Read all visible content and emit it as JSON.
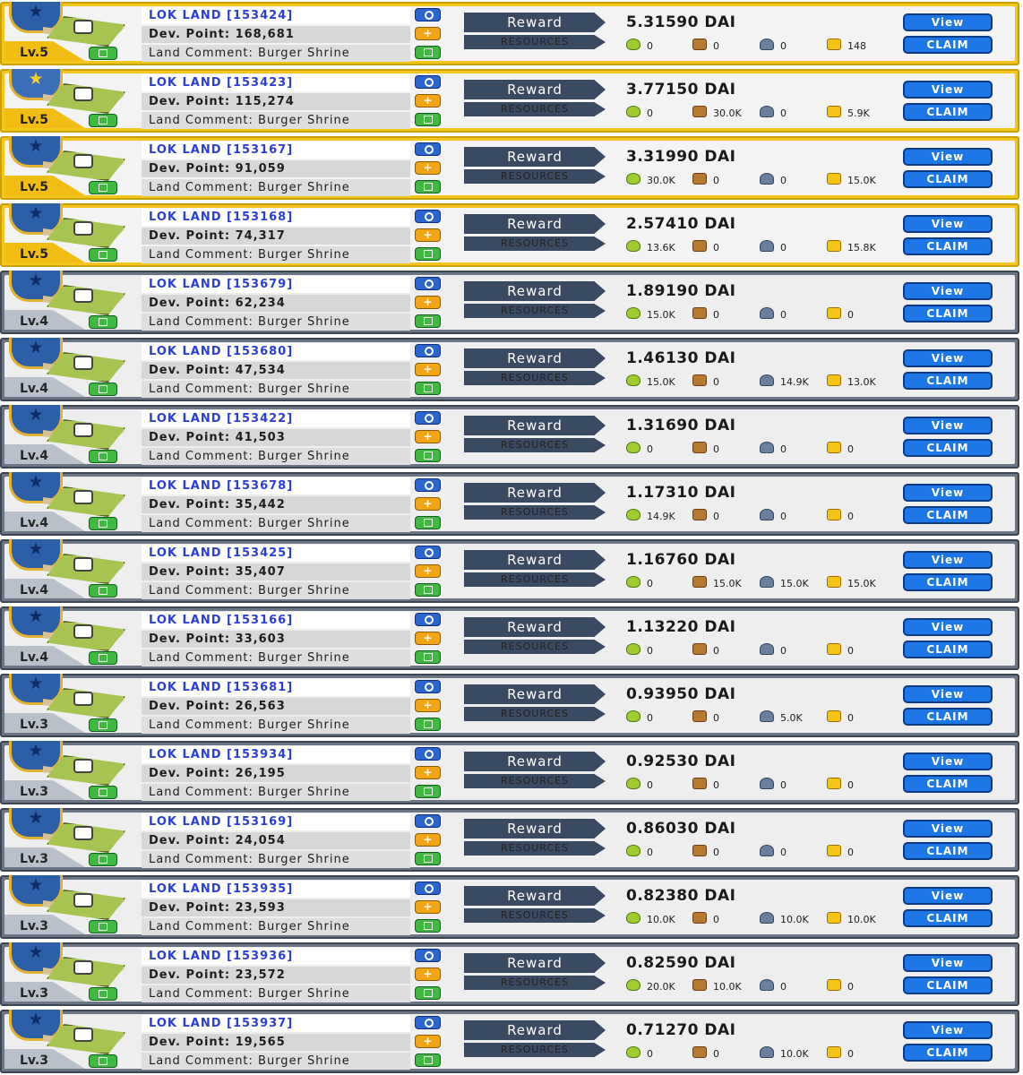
{
  "labels": {
    "reward": "Reward",
    "resources": "RESOURCES",
    "view": "View",
    "claim": "CLAIM"
  },
  "colors": {
    "gold_frame": "#f4c61c",
    "gray_frame": "#6b7584",
    "link_blue": "#2b3fd8",
    "button_blue": "#1d77e6",
    "tag_dark": "#3a4a63"
  },
  "icons": {
    "food": "corn-icon",
    "wood": "wood-icon",
    "stone": "stone-icon",
    "gold": "gold-icon",
    "search": "search-icon",
    "plus": "plus-icon",
    "edit": "edit-icon",
    "level": "star-shield-icon"
  },
  "lands": [
    {
      "tier": "gold",
      "level": "Lv.5",
      "name": "LOK LAND [153424]",
      "dev": "Dev. Point: 168,681",
      "comment": "Land Comment: Burger Shrine",
      "dai": "5.31590 DAI",
      "food": "0",
      "wood": "0",
      "stone": "0",
      "gold": "148"
    },
    {
      "tier": "gold",
      "level": "Lv.5",
      "name": "LOK LAND [153423]",
      "dev": "Dev. Point: 115,274",
      "comment": "Land Comment: Burger Shrine",
      "dai": "3.77150 DAI",
      "food": "0",
      "wood": "30.0K",
      "stone": "0",
      "gold": "5.9K",
      "yellow_star": true
    },
    {
      "tier": "gold",
      "level": "Lv.5",
      "name": "LOK LAND [153167]",
      "dev": "Dev. Point: 91,059",
      "comment": "Land Comment: Burger Shrine",
      "dai": "3.31990 DAI",
      "food": "30.0K",
      "wood": "0",
      "stone": "0",
      "gold": "15.0K"
    },
    {
      "tier": "gold",
      "level": "Lv.5",
      "name": "LOK LAND [153168]",
      "dev": "Dev. Point: 74,317",
      "comment": "Land Comment: Burger Shrine",
      "dai": "2.57410 DAI",
      "food": "13.6K",
      "wood": "0",
      "stone": "0",
      "gold": "15.8K"
    },
    {
      "tier": "gray",
      "level": "Lv.4",
      "name": "LOK LAND [153679]",
      "dev": "Dev. Point: 62,234",
      "comment": "Land Comment: Burger Shrine",
      "dai": "1.89190 DAI",
      "food": "15.0K",
      "wood": "0",
      "stone": "0",
      "gold": "0"
    },
    {
      "tier": "gray",
      "level": "Lv.4",
      "name": "LOK LAND [153680]",
      "dev": "Dev. Point: 47,534",
      "comment": "Land Comment: Burger Shrine",
      "dai": "1.46130 DAI",
      "food": "15.0K",
      "wood": "0",
      "stone": "14.9K",
      "gold": "13.0K"
    },
    {
      "tier": "gray",
      "level": "Lv.4",
      "name": "LOK LAND [153422]",
      "dev": "Dev. Point: 41,503",
      "comment": "Land Comment: Burger Shrine",
      "dai": "1.31690 DAI",
      "food": "0",
      "wood": "0",
      "stone": "0",
      "gold": "0"
    },
    {
      "tier": "gray",
      "level": "Lv.4",
      "name": "LOK LAND [153678]",
      "dev": "Dev. Point: 35,442",
      "comment": "Land Comment: Burger Shrine",
      "dai": "1.17310 DAI",
      "food": "14.9K",
      "wood": "0",
      "stone": "0",
      "gold": "0"
    },
    {
      "tier": "gray",
      "level": "Lv.4",
      "name": "LOK LAND [153425]",
      "dev": "Dev. Point: 35,407",
      "comment": "Land Comment: Burger Shrine",
      "dai": "1.16760 DAI",
      "food": "0",
      "wood": "15.0K",
      "stone": "15.0K",
      "gold": "15.0K"
    },
    {
      "tier": "gray",
      "level": "Lv.4",
      "name": "LOK LAND [153166]",
      "dev": "Dev. Point: 33,603",
      "comment": "Land Comment: Burger Shrine",
      "dai": "1.13220 DAI",
      "food": "0",
      "wood": "0",
      "stone": "0",
      "gold": "0"
    },
    {
      "tier": "gray",
      "level": "Lv.3",
      "name": "LOK LAND [153681]",
      "dev": "Dev. Point: 26,563",
      "comment": "Land Comment: Burger Shrine",
      "dai": "0.93950 DAI",
      "food": "0",
      "wood": "0",
      "stone": "5.0K",
      "gold": "0"
    },
    {
      "tier": "gray",
      "level": "Lv.3",
      "name": "LOK LAND [153934]",
      "dev": "Dev. Point: 26,195",
      "comment": "Land Comment: Burger Shrine",
      "dai": "0.92530 DAI",
      "food": "0",
      "wood": "0",
      "stone": "0",
      "gold": "0"
    },
    {
      "tier": "gray",
      "level": "Lv.3",
      "name": "LOK LAND [153169]",
      "dev": "Dev. Point: 24,054",
      "comment": "Land Comment: Burger Shrine",
      "dai": "0.86030 DAI",
      "food": "0",
      "wood": "0",
      "stone": "0",
      "gold": "0"
    },
    {
      "tier": "gray",
      "level": "Lv.3",
      "name": "LOK LAND [153935]",
      "dev": "Dev. Point: 23,593",
      "comment": "Land Comment: Burger Shrine",
      "dai": "0.82380 DAI",
      "food": "10.0K",
      "wood": "0",
      "stone": "10.0K",
      "gold": "10.0K"
    },
    {
      "tier": "gray",
      "level": "Lv.3",
      "name": "LOK LAND [153936]",
      "dev": "Dev. Point: 23,572",
      "comment": "Land Comment: Burger Shrine",
      "dai": "0.82590 DAI",
      "food": "20.0K",
      "wood": "10.0K",
      "stone": "0",
      "gold": "0"
    },
    {
      "tier": "gray",
      "level": "Lv.3",
      "name": "LOK LAND [153937]",
      "dev": "Dev. Point: 19,565",
      "comment": "Land Comment: Burger Shrine",
      "dai": "0.71270 DAI",
      "food": "0",
      "wood": "0",
      "stone": "10.0K",
      "gold": "0"
    }
  ]
}
